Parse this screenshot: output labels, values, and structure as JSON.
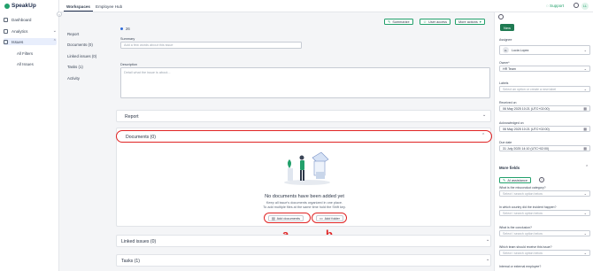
{
  "app": {
    "logo": "SpeakUp"
  },
  "sidebar": {
    "items": [
      {
        "label": "Dashboard"
      },
      {
        "label": "Analytics"
      },
      {
        "label": "Issues"
      }
    ],
    "issues_sub": [
      {
        "label": "All Filters"
      },
      {
        "label": "All Issues"
      }
    ]
  },
  "topbar": {
    "tabs": [
      {
        "label": "Workspaces"
      },
      {
        "label": "Employee Hub"
      }
    ],
    "support": "Support",
    "avatar": "LL"
  },
  "issue": {
    "id": "26"
  },
  "toolbar": {
    "summarize": "Summarize",
    "user_access": "User access",
    "more_actions": "More actions"
  },
  "sections_nav": [
    {
      "label": "Report"
    },
    {
      "label": "Documents (0)"
    },
    {
      "label": "Linked issues (0)"
    },
    {
      "label": "Tasks (1)"
    },
    {
      "label": "Activity"
    }
  ],
  "summary": {
    "label": "Summary",
    "placeholder": "Add a few words about this issue"
  },
  "description": {
    "label": "Description",
    "placeholder": "Detail what the issue is about..."
  },
  "report_panel": {
    "title": "Report"
  },
  "documents_panel": {
    "title": "Documents (0)",
    "empty_title": "No documents have been added yet",
    "empty_line1": "Keep all issue's documents organized in one place.",
    "empty_line2": "To add multiple files at the same time hold the Shift key.",
    "add_documents": "Add documents",
    "add_folder": "Add folder"
  },
  "linked_panel": {
    "title": "Linked issues (0)"
  },
  "tasks_panel": {
    "title": "Tasks (1)"
  },
  "annotations": {
    "a": "a",
    "b": "b"
  },
  "right": {
    "new_button": "New",
    "assignee_label": "Assignee",
    "assignee_avatar": "LL",
    "assignee": "Lucia Lopez",
    "owner_label": "Owner*",
    "owner": "HR Team",
    "labels_label": "Labels",
    "labels_placeholder": "Select an option or create a new label",
    "received_label": "Received on",
    "received": "06 May 2025 10:21 (UTC+02:00)",
    "ack_label": "Acknowledged on",
    "ack": "06 May 2025 10:21 (UTC+02:00)",
    "due_label": "Due date",
    "due": "31 July 2025 14:10 (UTC+02:00)",
    "more_fields": "More fields",
    "ai_assistance": "AI assistance",
    "q1_label": "What is the misconduct category?",
    "q2_label": "In which country did the incident happen?",
    "q3_label": "What is the conclusion?",
    "q4_label": "Which team should receive this issue?",
    "q5_label": "Internal or external employee?",
    "select_placeholder": "Select / search option below"
  },
  "colors": {
    "brand": "#22a06b",
    "annotation": "#e02424"
  }
}
